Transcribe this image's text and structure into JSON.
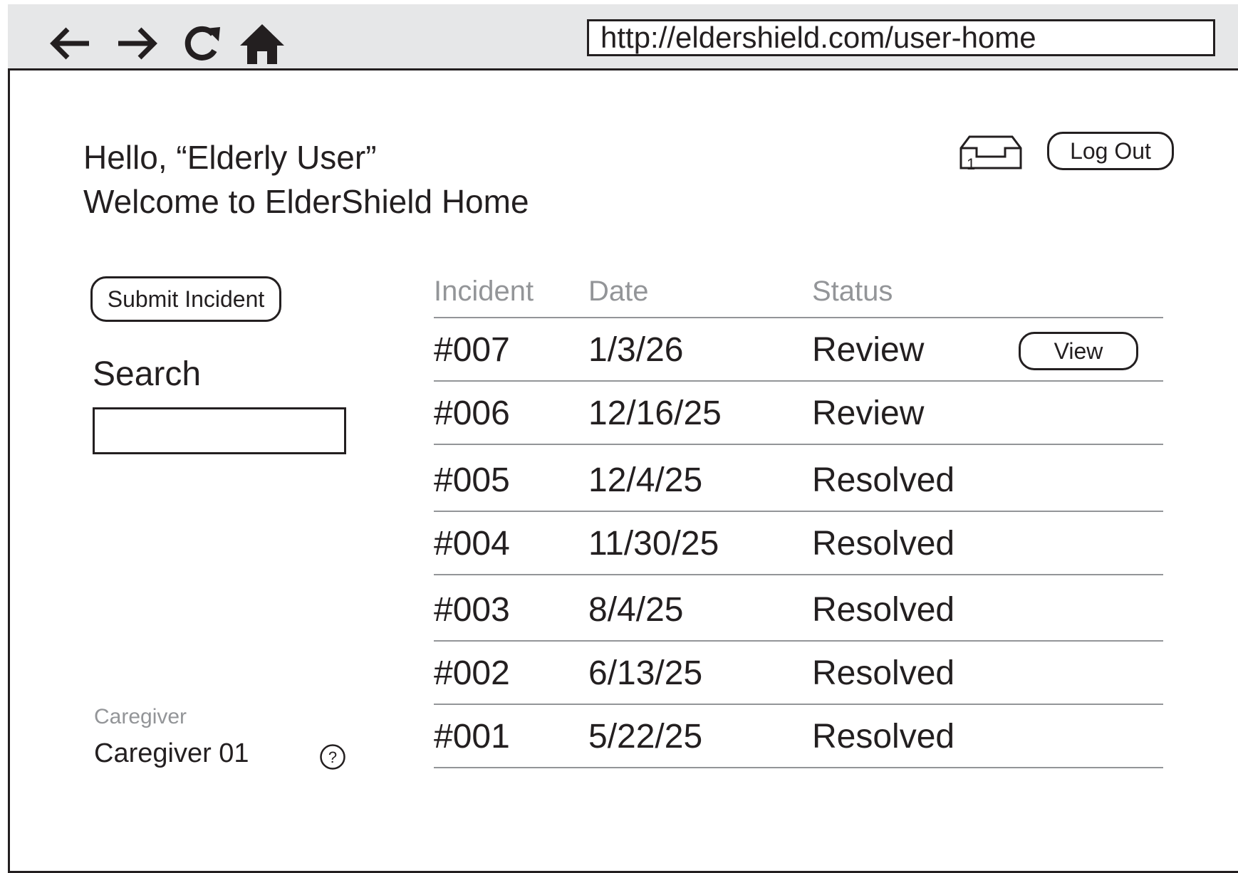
{
  "browser": {
    "url": "http://eldershield.com/user-home",
    "nav_icons": [
      "back-arrow-icon",
      "forward-arrow-icon",
      "reload-icon",
      "home-icon"
    ]
  },
  "header": {
    "greeting_line1": "Hello, “Elderly User”",
    "greeting_line2": "Welcome to ElderShield Home",
    "inbox_icon": "inbox-icon",
    "inbox_count": "1",
    "logout_label": "Log Out"
  },
  "sidebar": {
    "submit_label": "Submit Incident",
    "search_label": "Search",
    "search_value": "",
    "caregiver_label": "Caregiver",
    "caregiver_name": "Caregiver 01",
    "help_symbol": "?"
  },
  "table": {
    "headers": {
      "incident": "Incident",
      "date": "Date",
      "status": "Status"
    },
    "view_label": "View",
    "rows": [
      {
        "incident": "#007",
        "date": "1/3/26",
        "status": "Review"
      },
      {
        "incident": "#006",
        "date": "12/16/25",
        "status": "Review"
      },
      {
        "incident": "#005",
        "date": "12/4/25",
        "status": "Resolved"
      },
      {
        "incident": "#004",
        "date": "11/30/25",
        "status": "Resolved"
      },
      {
        "incident": "#003",
        "date": "8/4/25",
        "status": "Resolved"
      },
      {
        "incident": "#002",
        "date": "6/13/25",
        "status": "Resolved"
      },
      {
        "incident": "#001",
        "date": "5/22/25",
        "status": "Resolved"
      }
    ]
  }
}
